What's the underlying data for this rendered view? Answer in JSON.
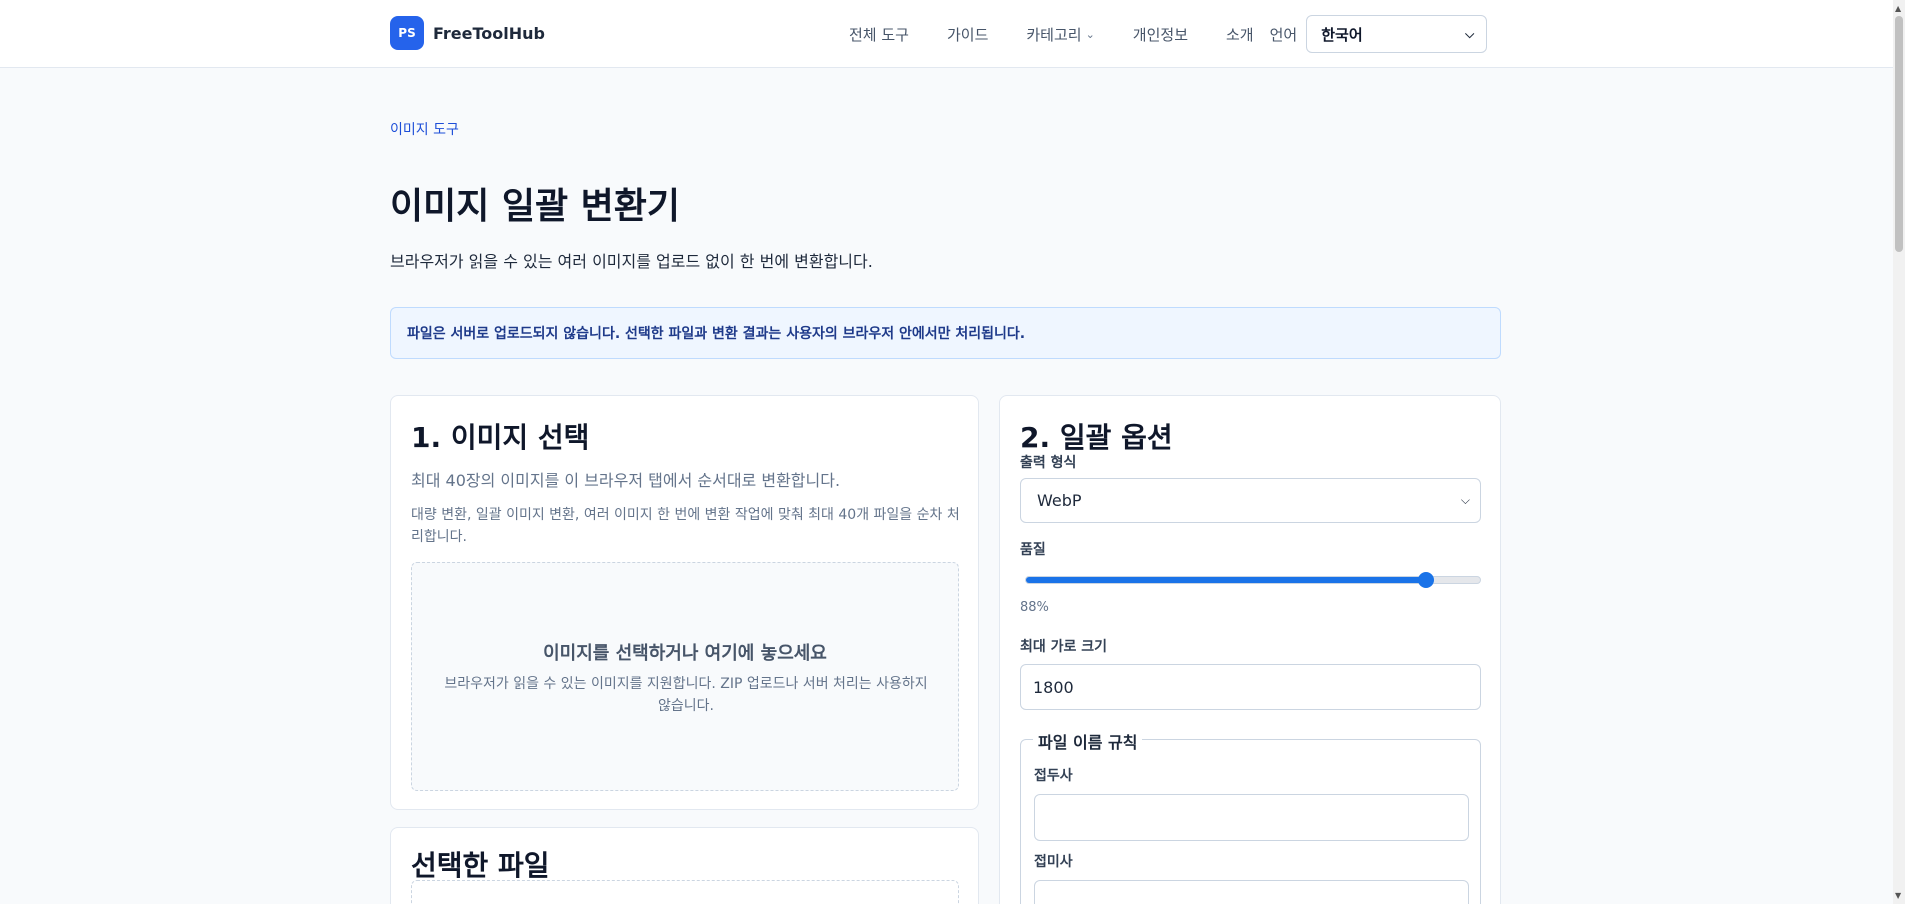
{
  "header": {
    "logo_badge": "PS",
    "logo_text": "FreeToolHub",
    "nav": [
      {
        "label": "전체 도구"
      },
      {
        "label": "가이드"
      },
      {
        "label": "카테고리"
      },
      {
        "label": "개인정보"
      },
      {
        "label": "소개"
      }
    ],
    "language_label": "언어",
    "language_value": "한국어"
  },
  "page": {
    "breadcrumb": "이미지 도구",
    "title": "이미지 일괄 변환기",
    "description": "브라우저가 읽을 수 있는 여러 이미지를 업로드 없이 한 번에 변환합니다.",
    "notice": "파일은 서버로 업로드되지 않습니다. 선택한 파일과 변환 결과는 사용자의 브라우저 안에서만 처리됩니다."
  },
  "select_card": {
    "title": "1. 이미지 선택",
    "subtitle": "최대 40장의 이미지를 이 브라우저 탭에서 순서대로 변환합니다.",
    "help": "대량 변환, 일괄 이미지 변환, 여러 이미지 한 번에 변환 작업에 맞춰 최대 40개 파일을 순차 처리합니다.",
    "dropzone_title": "이미지를 선택하거나 여기에 놓으세요",
    "dropzone_sub": "브라우저가 읽을 수 있는 이미지를 지원합니다. ZIP 업로드나 서버 처리는 사용하지 않습니다."
  },
  "files_card": {
    "title": "선택한 파일"
  },
  "options_card": {
    "title": "2. 일괄 옵션",
    "format_label": "출력 형식",
    "format_value": "WebP",
    "quality_label": "품질",
    "quality_percent": 88,
    "quality_text": "88%",
    "max_width_label": "최대 가로 크기",
    "max_width_value": "1800",
    "naming_legend": "파일 이름 규칙",
    "prefix_label": "접두사",
    "suffix_label": "접미사"
  },
  "colors": {
    "accent": "#2563eb",
    "slider": "#1a73e8",
    "notice_bg": "#eff6ff",
    "notice_text": "#1e3a8a"
  }
}
